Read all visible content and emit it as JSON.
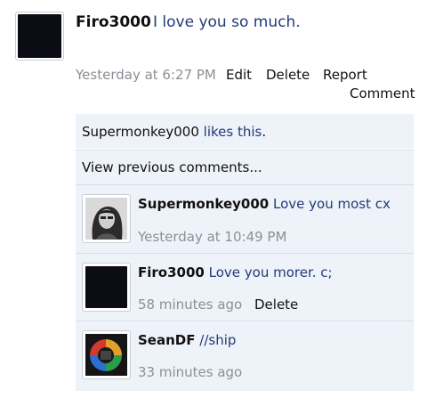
{
  "post": {
    "author": "Firo3000",
    "text": "I love you so much.",
    "time": "Yesterday at 6:27 PM",
    "actions": [
      "Edit",
      "Delete",
      "Report",
      "Comment"
    ]
  },
  "likes": {
    "name": "Supermonkey000",
    "rest": "likes this",
    "period": "."
  },
  "view_previous": "View previous comments...",
  "comments": [
    {
      "author": "Supermonkey000",
      "text": "Love you most cx",
      "time": "Yesterday at 10:49 PM",
      "action": ""
    },
    {
      "author": "Firo3000",
      "text": "Love you morer. c;",
      "time": "58 minutes ago",
      "action": "Delete"
    },
    {
      "author": "SeanDF",
      "text": "//ship",
      "time": "33 minutes ago",
      "action": ""
    }
  ]
}
